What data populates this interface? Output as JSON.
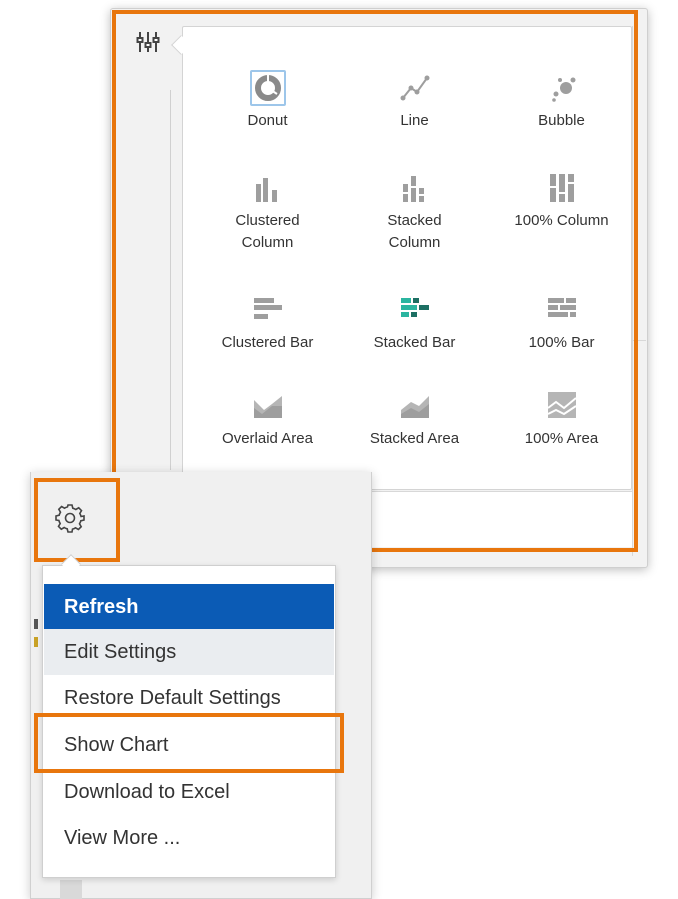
{
  "chart_picker": {
    "options": [
      {
        "label": "Donut",
        "icon": "donut-chart-icon",
        "selected": true
      },
      {
        "label": "Line",
        "icon": "line-chart-icon"
      },
      {
        "label": "Bubble",
        "icon": "bubble-chart-icon"
      },
      {
        "label": "Clustered\nColumn",
        "icon": "clustered-column-icon"
      },
      {
        "label": "Stacked\nColumn",
        "icon": "stacked-column-icon"
      },
      {
        "label": "100% Column",
        "icon": "percent-column-icon"
      },
      {
        "label": "Clustered Bar",
        "icon": "clustered-bar-icon"
      },
      {
        "label": "Stacked Bar",
        "icon": "stacked-bar-icon"
      },
      {
        "label": "100% Bar",
        "icon": "percent-bar-icon"
      },
      {
        "label": "Overlaid Area",
        "icon": "overlaid-area-icon"
      },
      {
        "label": "Stacked Area",
        "icon": "stacked-area-icon"
      },
      {
        "label": "100% Area",
        "icon": "percent-area-icon"
      }
    ]
  },
  "menu": {
    "items": [
      {
        "label": "Refresh",
        "state": "active"
      },
      {
        "label": "Edit Settings",
        "state": "hover"
      },
      {
        "label": "Restore Default Settings"
      },
      {
        "label": "Show Chart"
      },
      {
        "label": "Download to Excel"
      },
      {
        "label": "View More ..."
      }
    ]
  },
  "colors": {
    "highlight": "#e8760d",
    "menu_active": "#0b5bb5",
    "icon_gray": "#9e9e9e",
    "icon_teal": "#2bb5a0",
    "selected_border": "#9dc6ea"
  }
}
